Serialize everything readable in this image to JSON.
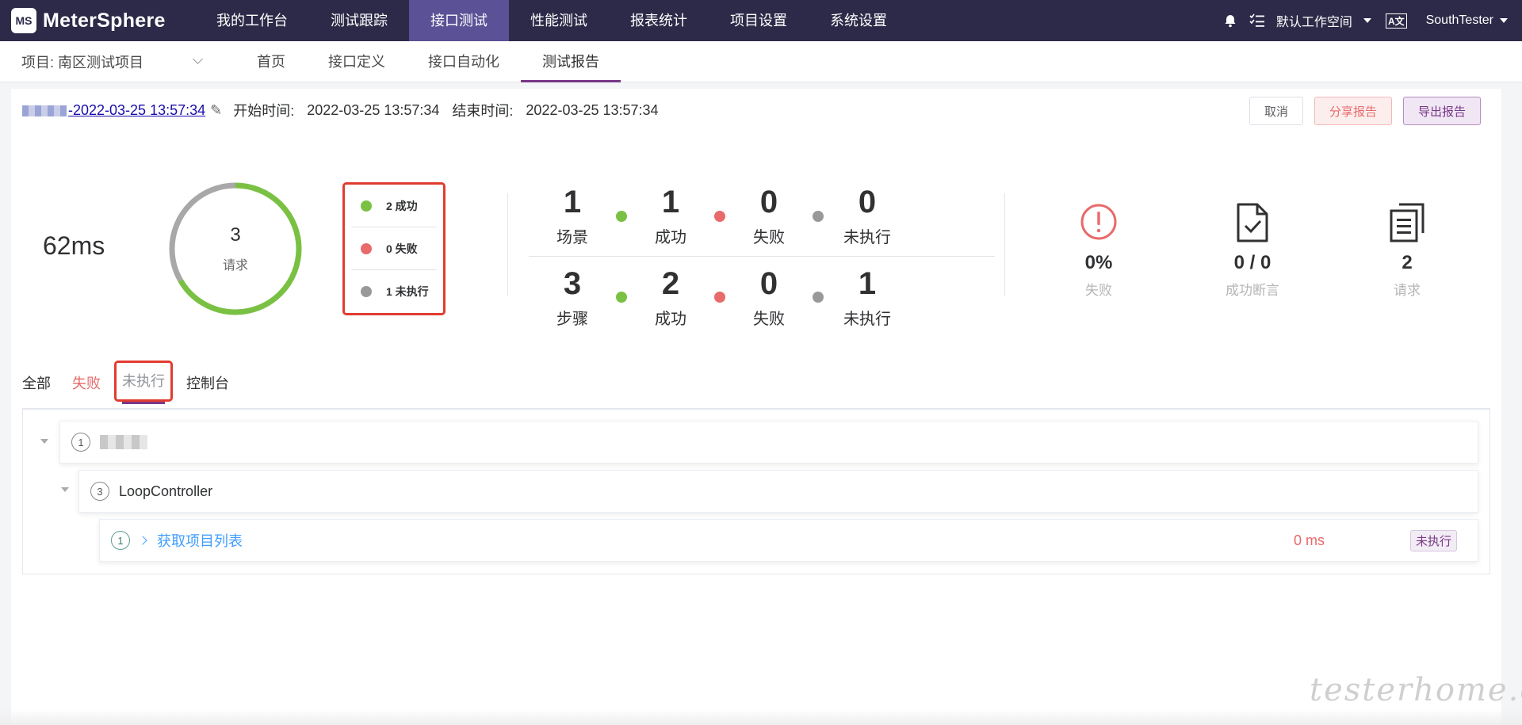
{
  "app": {
    "logo_badge": "MS",
    "logo_text": "MeterSphere"
  },
  "menu": [
    "我的工作台",
    "测试跟踪",
    "接口测试",
    "性能测试",
    "报表统计",
    "项目设置",
    "系统设置"
  ],
  "nav_right": {
    "workspace": "默认工作空间",
    "lang": "A文",
    "user": "SouthTester"
  },
  "project": {
    "label": "项目: 南区测试项目"
  },
  "subtabs": [
    "首页",
    "接口定义",
    "接口自动化",
    "测试报告"
  ],
  "report": {
    "name_suffix": "-2022-03-25 13:57:34",
    "start_label": "开始时间:",
    "start_value": "2022-03-25 13:57:34",
    "end_label": "结束时间:",
    "end_value": "2022-03-25 13:57:34"
  },
  "buttons": {
    "cancel": "取消",
    "share": "分享报告",
    "export": "导出报告"
  },
  "summary": {
    "duration": "62ms",
    "total": "3",
    "total_label": "请求",
    "success_count": 2,
    "fail_count": 0,
    "unexecuted_count": 1,
    "legend_success": "2 成功",
    "legend_fail": "0 失败",
    "legend_unexec": "1 未执行"
  },
  "stats": {
    "scenario": {
      "label": "场景",
      "total": "1",
      "success": "1",
      "fail": "0",
      "unexec": "0"
    },
    "step": {
      "label": "步骤",
      "total": "3",
      "success": "2",
      "fail": "0",
      "unexec": "1"
    },
    "success_label": "成功",
    "fail_label": "失败",
    "unexec_label": "未执行"
  },
  "metrics": {
    "fail_rate": {
      "value": "0%",
      "label": "失败"
    },
    "assertion": {
      "value": "0 / 0",
      "label": "成功断言"
    },
    "requests": {
      "value": "2",
      "label": "请求"
    }
  },
  "result_tabs": [
    "全部",
    "失败",
    "未执行",
    "控制台"
  ],
  "tree": {
    "root_index": "1",
    "loop_index": "3",
    "loop_name": "LoopController",
    "req_index": "1",
    "req_name": "获取项目列表",
    "req_time": "0 ms",
    "req_status": "未执行"
  },
  "watermark": "testerhome.com",
  "colors": {
    "nav": "#2c2a48",
    "accent": "#783887",
    "success": "#7ac143",
    "fail": "#e86a6a",
    "unexec": "#999999"
  }
}
